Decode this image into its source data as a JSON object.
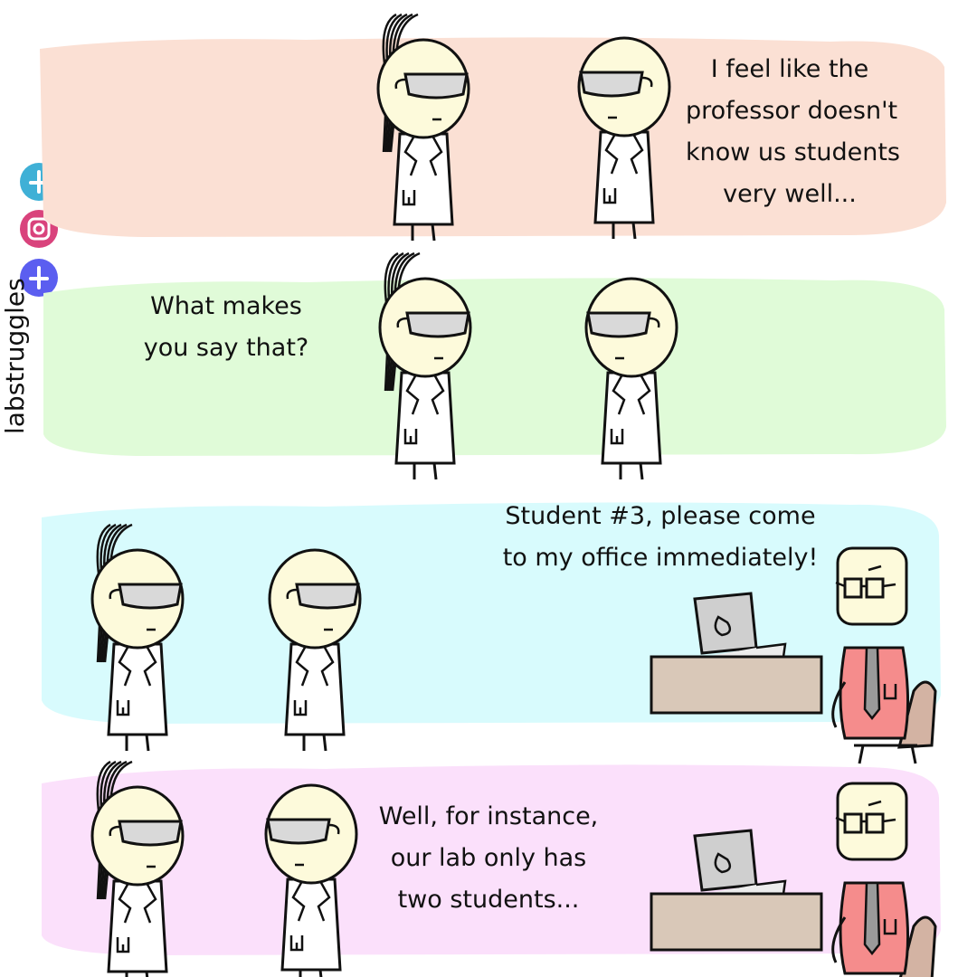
{
  "brand": {
    "name": "labstruggles"
  },
  "social_icons": [
    {
      "name": "plus-icon",
      "color": "#3fb0d6"
    },
    {
      "name": "instagram-icon",
      "color": "#d9437c"
    },
    {
      "name": "facebook-icon",
      "color": "#5b5ef0"
    }
  ],
  "panels": [
    {
      "bg": "#fbe0d4",
      "speech": [
        "I feel like the",
        "professor doesn't",
        "know us students",
        "very well..."
      ]
    },
    {
      "bg": "#e0fbd8",
      "speech": [
        "What makes",
        "you say that?"
      ]
    },
    {
      "bg": "#d8fbfd",
      "speech": [
        "Student #3, please come",
        "to my office immediately!"
      ]
    },
    {
      "bg": "#fbe0fb",
      "speech": [
        "Well, for instance,",
        "our lab only has",
        "two students..."
      ]
    }
  ],
  "colors": {
    "skin": "#fdfadb",
    "outline": "#111111",
    "goggles": "#d9d9d9",
    "shirt": "#f58c8c",
    "desk": "#d9c8b8",
    "chair": "#d3b3a3",
    "monitor": "#cfcfcf"
  }
}
